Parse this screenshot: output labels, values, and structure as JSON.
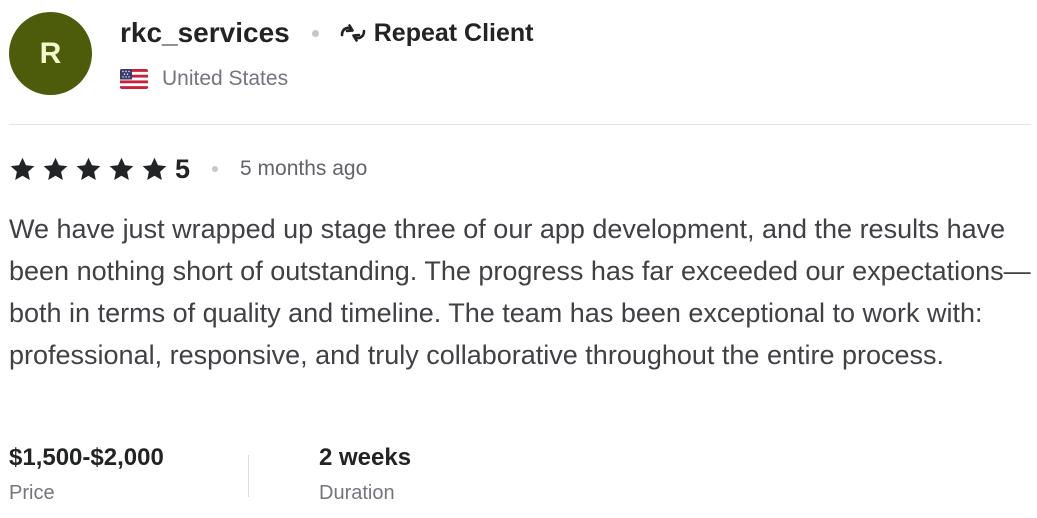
{
  "reviewer": {
    "avatar_initial": "R",
    "avatar_color": "#4d5c0b",
    "username": "rkc_services",
    "badge": {
      "icon": "repeat-icon",
      "label": "Repeat Client"
    },
    "country": {
      "flag_icon": "us-flag-icon",
      "name": "United States"
    }
  },
  "review": {
    "rating_stars": 5,
    "rating_value": "5",
    "time_ago": "5 months ago",
    "text": "We have just wrapped up stage three of our app development, and the results have been nothing short of outstanding. The progress has far exceeded our expectations—both in terms of quality and timeline. The team has been exceptional to work with: professional, responsive, and truly collaborative throughout the entire process."
  },
  "meta": {
    "price": {
      "value": "$1,500-$2,000",
      "label": "Price"
    },
    "duration": {
      "value": "2 weeks",
      "label": "Duration"
    }
  }
}
